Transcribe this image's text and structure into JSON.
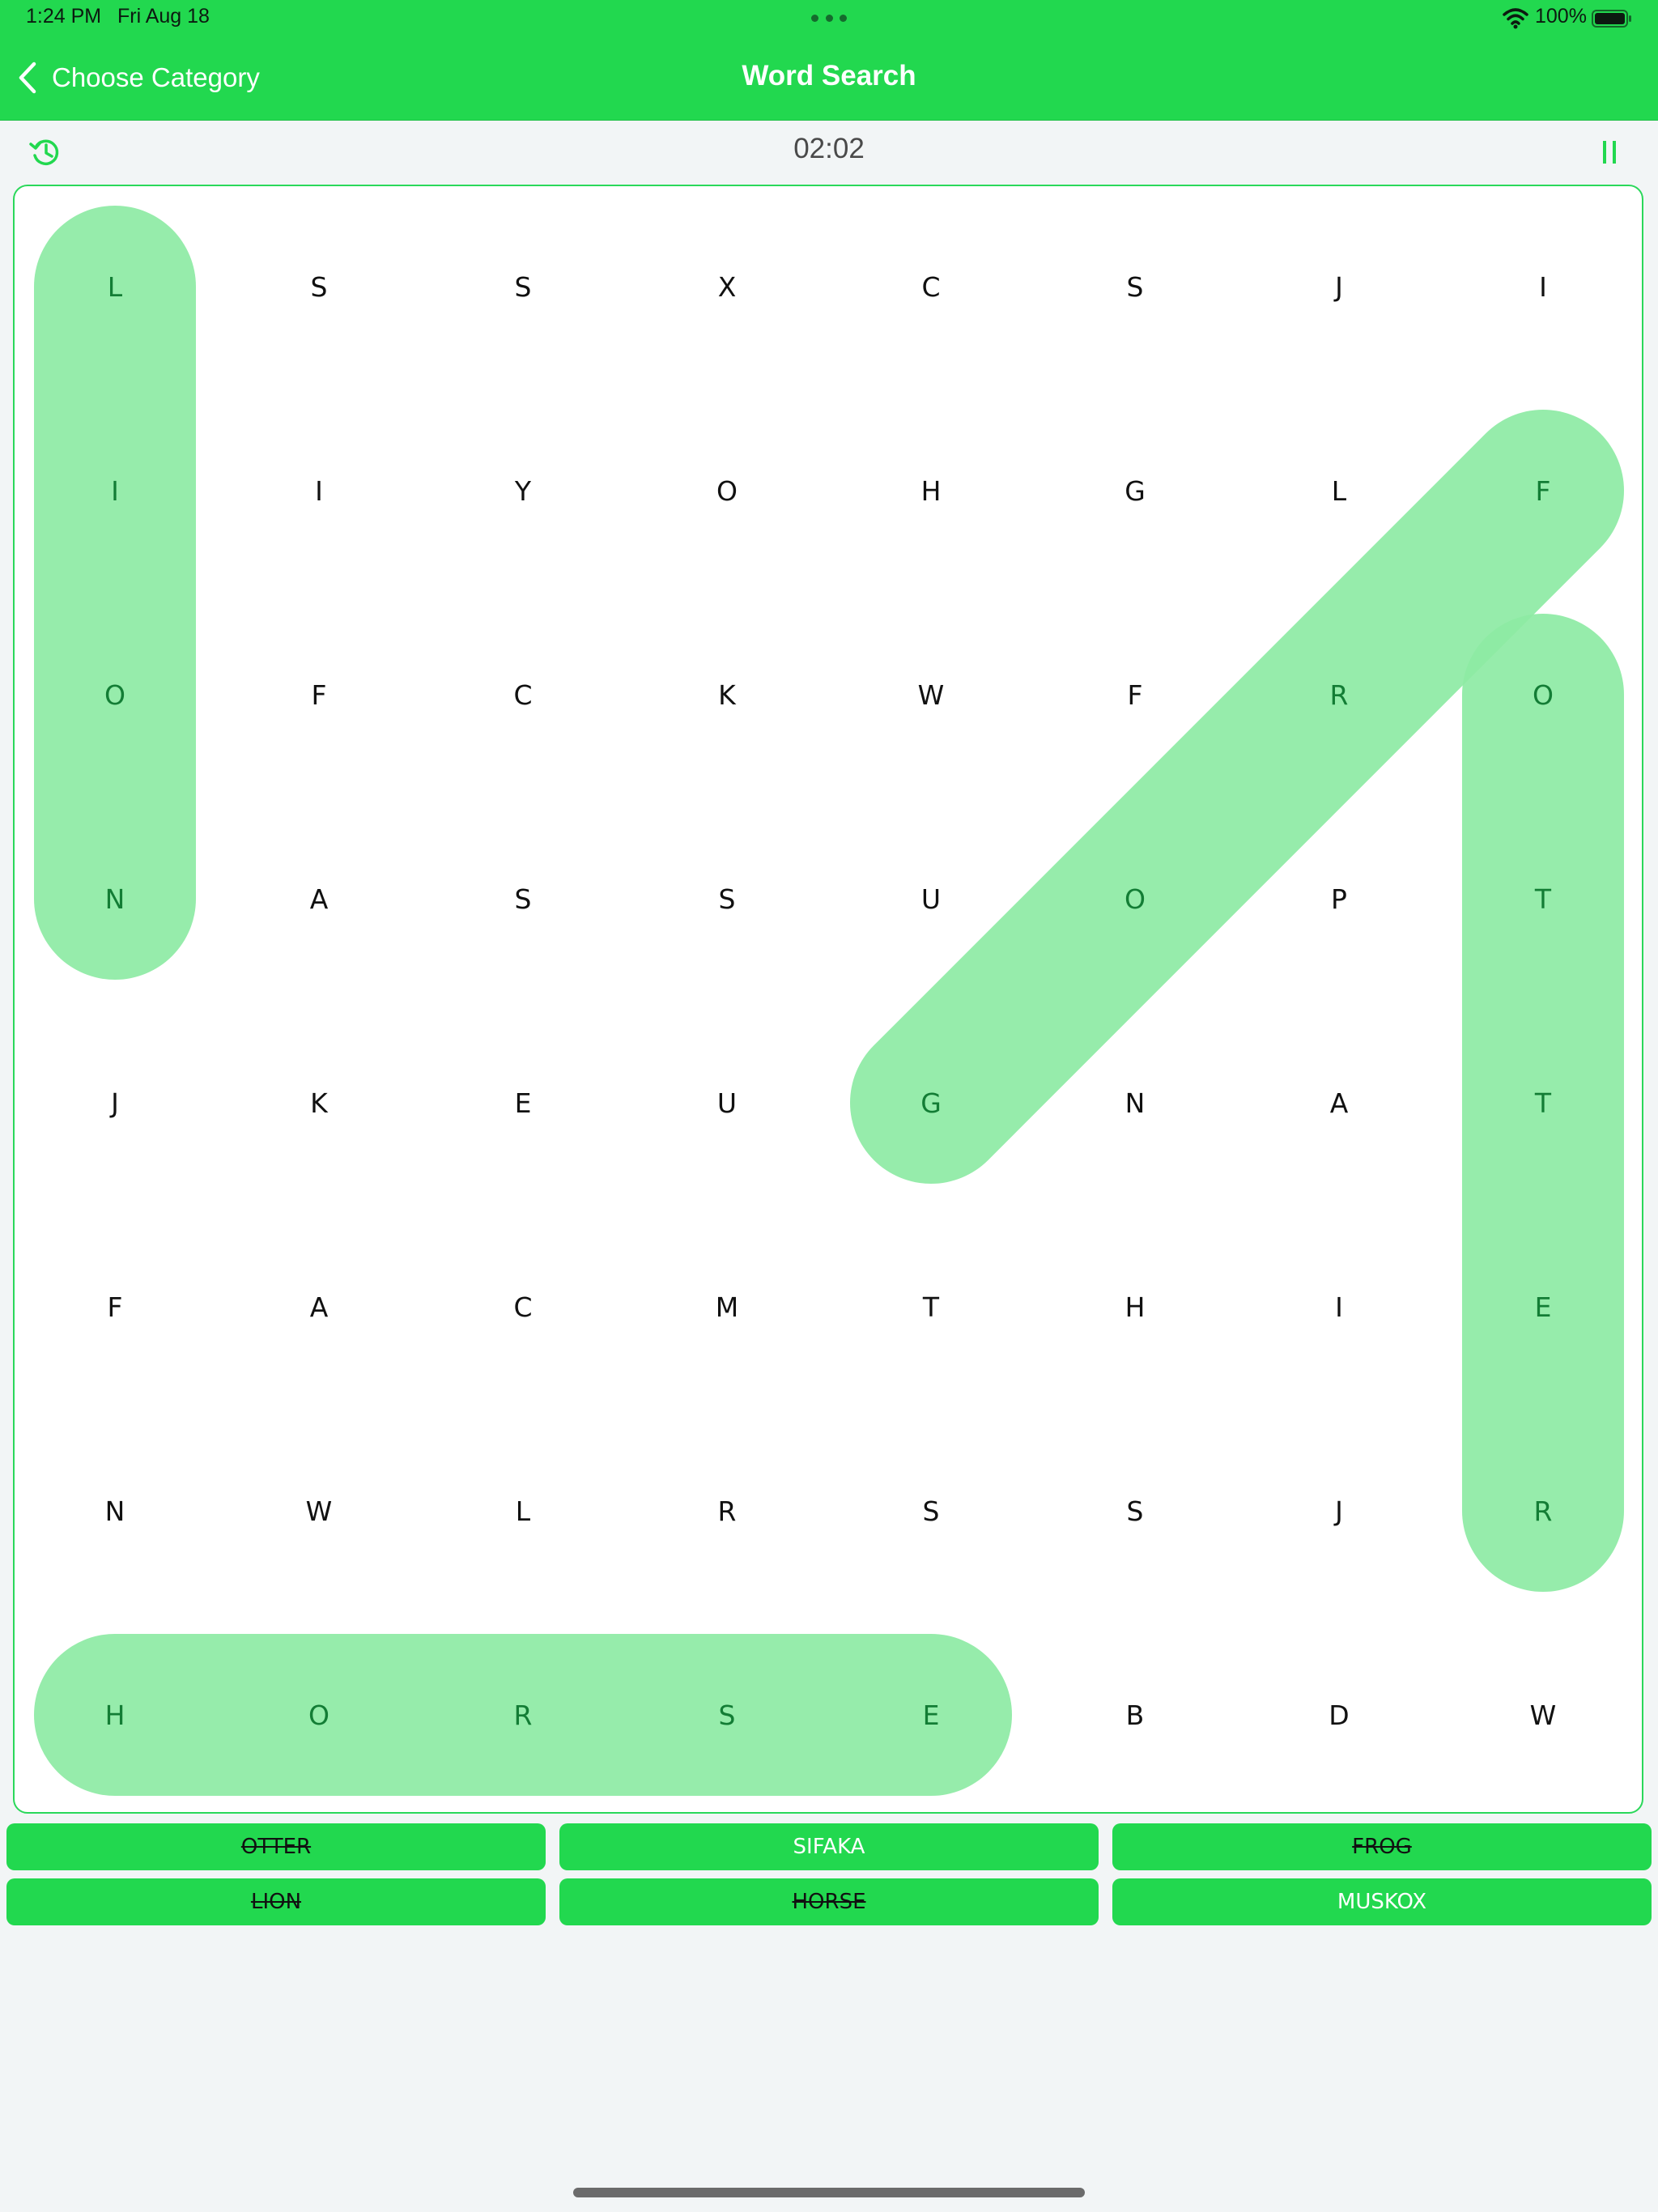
{
  "status": {
    "time": "1:24 PM",
    "date": "Fri Aug 18",
    "battery": "100%",
    "icons": [
      "more-dots-icon",
      "wifi-icon",
      "battery-icon"
    ]
  },
  "nav": {
    "back_label": "Choose Category",
    "title": "Word Search",
    "icons": [
      "chevron-left-icon"
    ]
  },
  "toolbar": {
    "timer": "02:02",
    "icons": [
      "history-icon",
      "pause-icon"
    ]
  },
  "colors": {
    "brand": "#22d84f",
    "highlight": "#8eeba4",
    "found_text": "#137d35",
    "background": "#f2f5f6"
  },
  "grid": {
    "rows": [
      [
        "L",
        "S",
        "S",
        "X",
        "C",
        "S",
        "J",
        "I"
      ],
      [
        "I",
        "I",
        "Y",
        "O",
        "H",
        "G",
        "L",
        "F"
      ],
      [
        "O",
        "F",
        "C",
        "K",
        "W",
        "F",
        "R",
        "O"
      ],
      [
        "N",
        "A",
        "S",
        "S",
        "U",
        "O",
        "P",
        "T"
      ],
      [
        "J",
        "K",
        "E",
        "U",
        "G",
        "N",
        "A",
        "T"
      ],
      [
        "F",
        "A",
        "C",
        "M",
        "T",
        "H",
        "I",
        "E"
      ],
      [
        "N",
        "W",
        "L",
        "R",
        "S",
        "S",
        "J",
        "R"
      ],
      [
        "H",
        "O",
        "R",
        "S",
        "E",
        "B",
        "D",
        "W"
      ]
    ],
    "found": [
      {
        "word": "LION",
        "start": [
          0,
          0
        ],
        "end": [
          3,
          0
        ]
      },
      {
        "word": "FROG",
        "start": [
          1,
          7
        ],
        "end": [
          4,
          4
        ]
      },
      {
        "word": "OTTER",
        "start": [
          2,
          7
        ],
        "end": [
          6,
          7
        ]
      },
      {
        "word": "HORSE",
        "start": [
          7,
          0
        ],
        "end": [
          7,
          4
        ]
      }
    ]
  },
  "words": [
    {
      "label": "OTTER",
      "found": true
    },
    {
      "label": "SIFAKA",
      "found": false
    },
    {
      "label": "FROG",
      "found": true
    },
    {
      "label": "LION",
      "found": true
    },
    {
      "label": "HORSE",
      "found": true
    },
    {
      "label": "MUSKOX",
      "found": false
    }
  ]
}
